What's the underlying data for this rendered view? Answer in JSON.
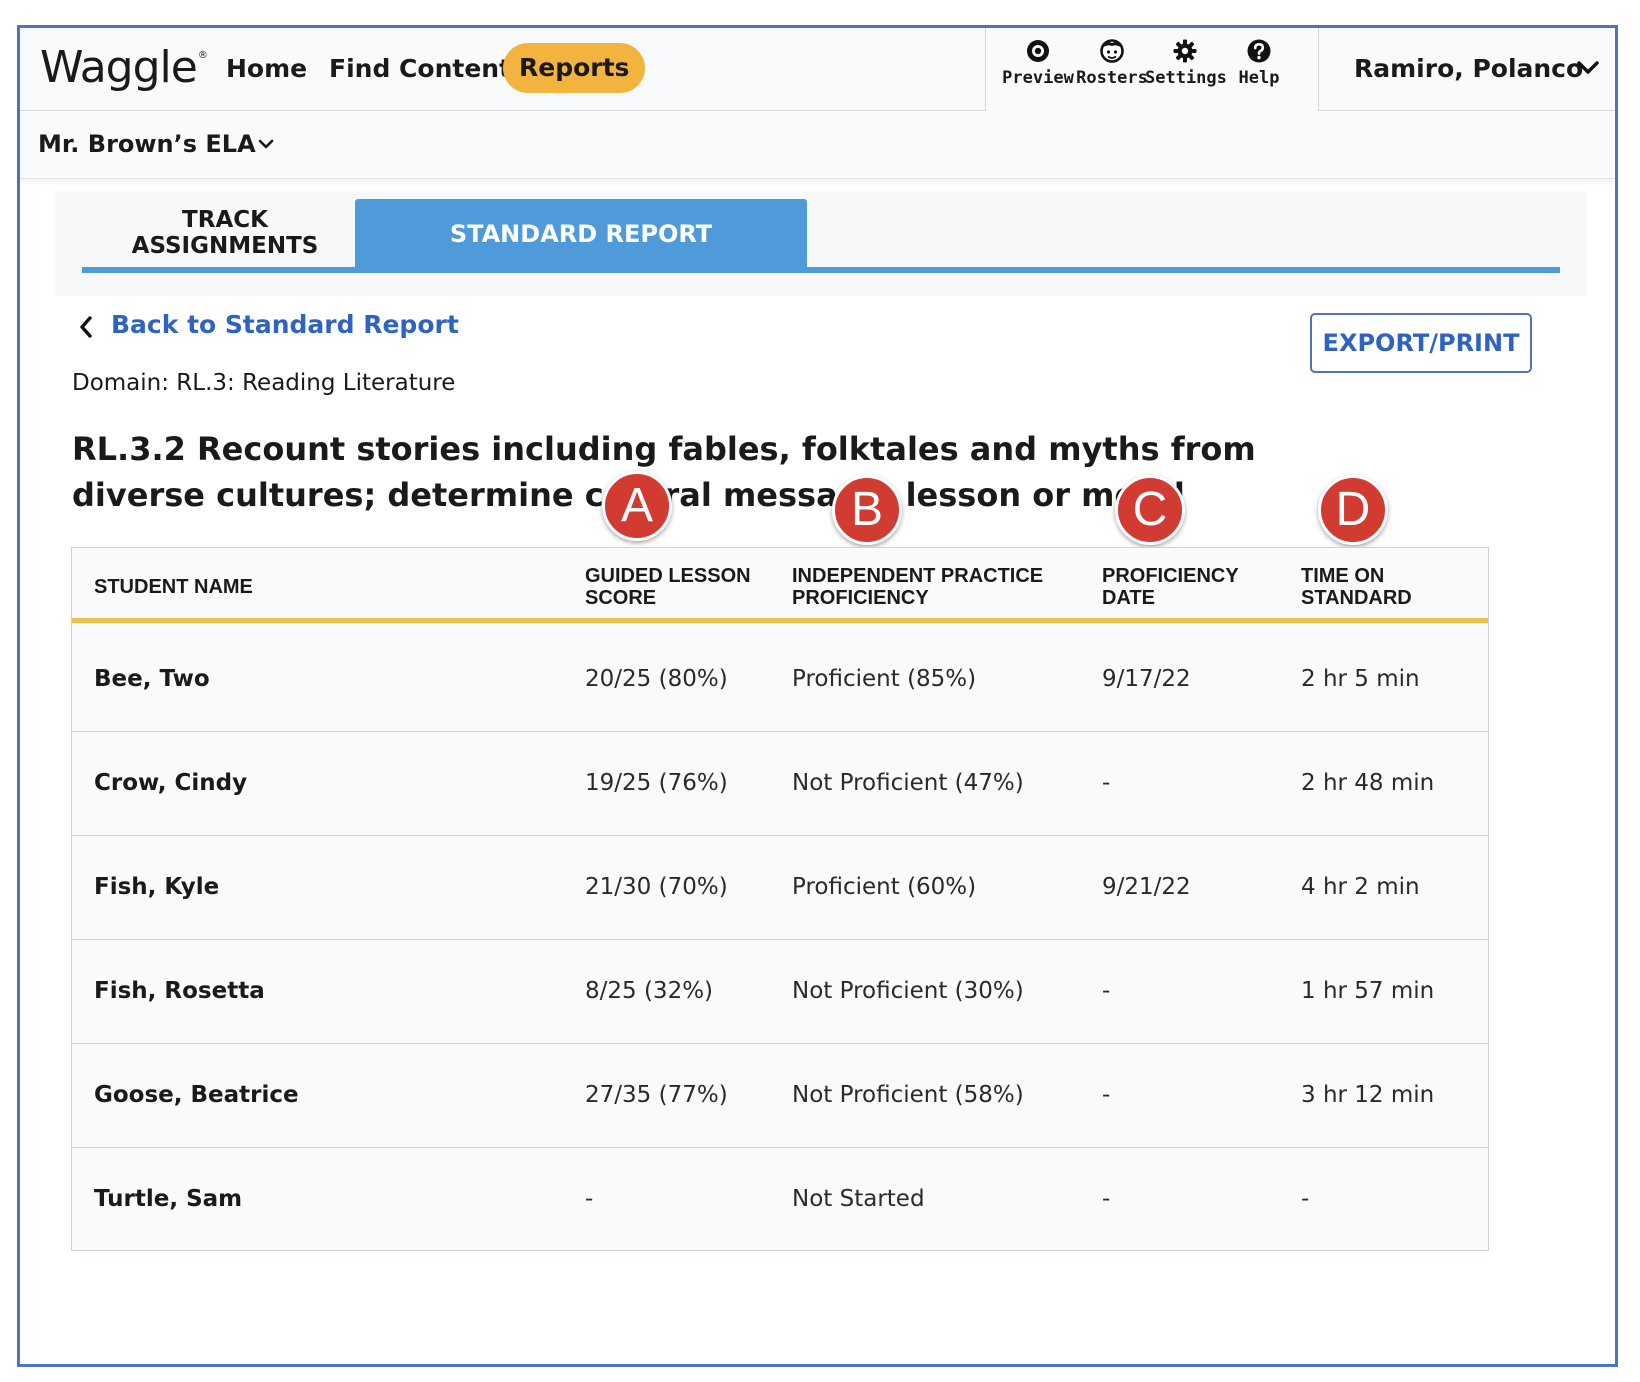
{
  "app": {
    "logo": "Waggle",
    "logo_mark": "®"
  },
  "nav": {
    "home": "Home",
    "find_content": "Find Content",
    "reports": "Reports"
  },
  "tools": {
    "preview": "Preview",
    "rosters": "Rosters",
    "settings": "Settings",
    "help": "Help"
  },
  "user": {
    "name": "Ramiro, Polanco"
  },
  "class_selector": {
    "label": "Mr. Brown’s ELA"
  },
  "tabs": {
    "track_line1": "TRACK",
    "track_line2": "ASSIGNMENTS",
    "standard_report": "STANDARD REPORT",
    "active": "standard_report"
  },
  "back_link": "Back to Standard Report",
  "export_button": "EXPORT/PRINT",
  "domain": "Domain: RL.3: Reading Literature",
  "standard_title": "RL.3.2 Recount stories including fables, folktales and myths from diverse cultures; determine central message, lesson or moral",
  "markers": [
    "A",
    "B",
    "C",
    "D"
  ],
  "table": {
    "headers": {
      "name": "STUDENT NAME",
      "guided_line1": "GUIDED LESSON",
      "guided_line2": "SCORE",
      "indep_line1": "INDEPENDENT PRACTICE",
      "indep_line2": "PROFICIENCY",
      "date_line1": "PROFICIENCY",
      "date_line2": "DATE",
      "time_line1": "TIME ON",
      "time_line2": "STANDARD"
    },
    "rows": [
      {
        "name": "Bee, Two",
        "guided": "20/25 (80%)",
        "independent": "Proficient (85%)",
        "date": "9/17/22",
        "time": "2 hr 5 min"
      },
      {
        "name": "Crow, Cindy",
        "guided": "19/25 (76%)",
        "independent": "Not Proficient (47%)",
        "date": "-",
        "time": "2 hr 48 min"
      },
      {
        "name": "Fish, Kyle",
        "guided": "21/30 (70%)",
        "independent": "Proficient (60%)",
        "date": "9/21/22",
        "time": "4 hr 2 min"
      },
      {
        "name": "Fish, Rosetta",
        "guided": "8/25 (32%)",
        "independent": "Not Proficient (30%)",
        "date": "-",
        "time": "1 hr 57 min"
      },
      {
        "name": "Goose, Beatrice",
        "guided": "27/35 (77%)",
        "independent": "Not Proficient (58%)",
        "date": "-",
        "time": "3 hr 12 min"
      },
      {
        "name": "Turtle, Sam",
        "guided": "-",
        "independent": "Not Started",
        "date": "-",
        "time": "-"
      }
    ]
  },
  "colors": {
    "frame_border": "#4f72c4",
    "reports_pill": "#f2b43e",
    "tab_active": "#4f9bd9",
    "link": "#2f63c0",
    "header_rule": "#f2c04a",
    "marker": "#d23b32"
  },
  "icons": {
    "preview": "eye-icon",
    "rosters": "face-icon",
    "settings": "gear-icon",
    "help": "question-icon",
    "user_menu": "chevron-down-icon",
    "class_menu": "chevron-down-icon",
    "back": "chevron-left-icon"
  }
}
